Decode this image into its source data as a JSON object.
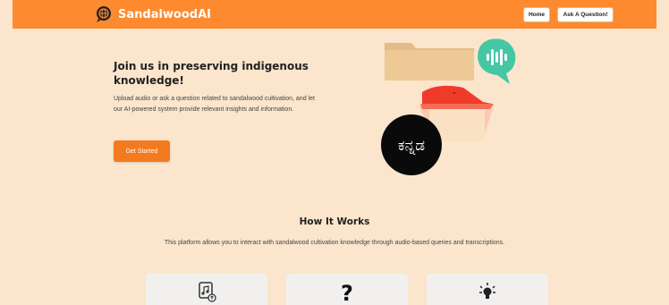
{
  "navbar": {
    "brand": "SandalwoodAI",
    "home_label": "Home",
    "ask_label": "Ask A Question!",
    "bg_color": "#fd8a2f"
  },
  "hero": {
    "title": "Join us in preserving indigenous knowledge!",
    "description": "Upload audio or ask a question related to sandalwood cultivation, and let our AI-powered system provide relevant insights and information.",
    "cta_label": "Get Started",
    "kannada_text": "ಕನ್ನಡ"
  },
  "how_it_works": {
    "title": "How It Works",
    "description": "This platform allows you to interact with sandalwood cultivation knowledge through audio-based queries and transcriptions.",
    "cards": [
      {
        "icon": "music-file-icon"
      },
      {
        "icon": "question-icon",
        "glyph": "?"
      },
      {
        "icon": "lightbulb-icon"
      }
    ]
  },
  "colors": {
    "page_bg": "#fbe5cc",
    "accent": "#f37a1f",
    "teal": "#45c7a4"
  }
}
